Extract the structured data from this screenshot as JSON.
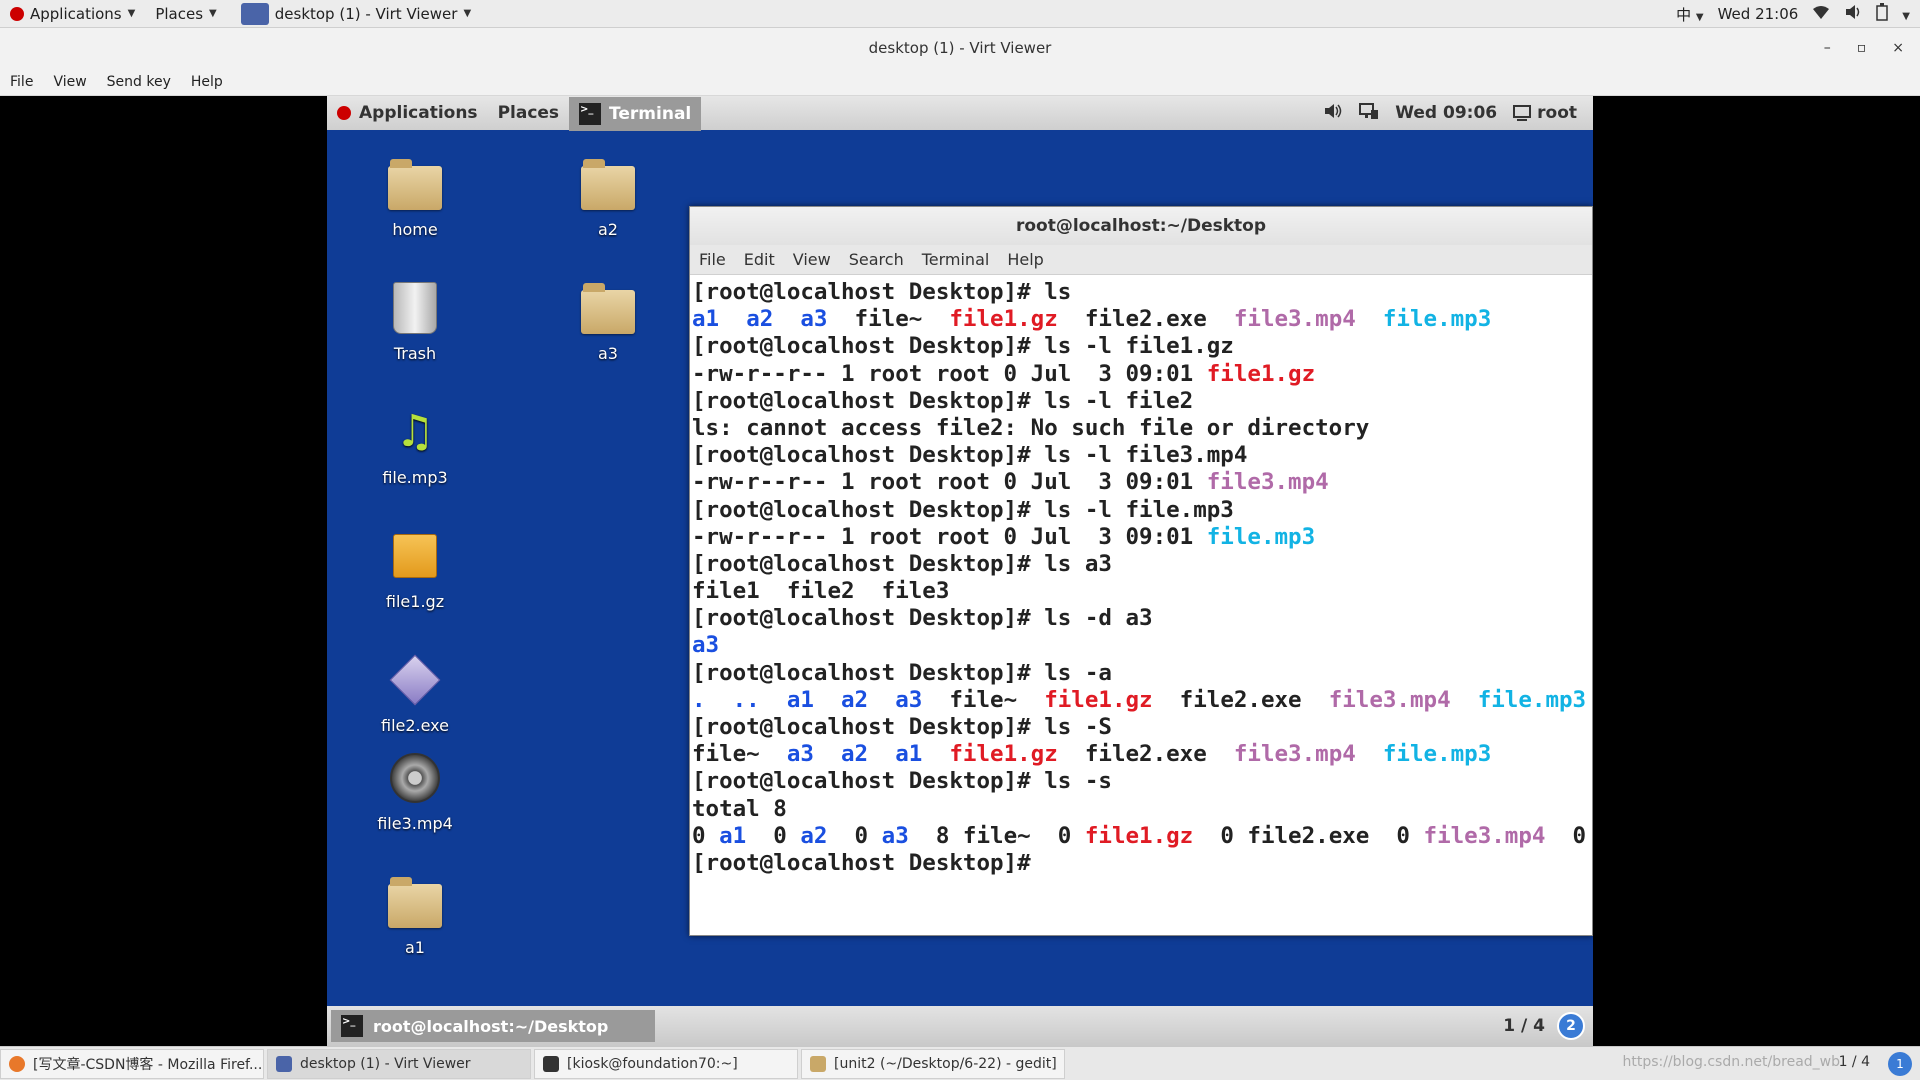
{
  "host": {
    "topbar": {
      "applications": "Applications",
      "places": "Places",
      "window_title": "desktop (1) - Virt Viewer",
      "input_method": "中",
      "clock": "Wed 21:06"
    },
    "viewer_title": "desktop (1) - Virt Viewer",
    "viewer_controls": [
      "–",
      "▫",
      "×"
    ],
    "menu": [
      "File",
      "View",
      "Send key",
      "Help"
    ],
    "taskbar": [
      {
        "label": "[写文章-CSDN博客 - Mozilla Firef...",
        "icon_color": "#e8782a"
      },
      {
        "label": "desktop (1) - Virt Viewer",
        "icon_color": "#4a64a8"
      },
      {
        "label": "[kiosk@foundation70:~]",
        "icon_color": "#333333"
      },
      {
        "label": "[unit2 (~/Desktop/6-22) - gedit]",
        "icon_color": "#c9a868"
      }
    ],
    "watermark": "https://blog.csdn.net/bread_wb",
    "pager": "1 / 4",
    "badge": "1"
  },
  "vm": {
    "topbar": {
      "applications": "Applications",
      "places": "Places",
      "terminal_tab": "Terminal",
      "clock": "Wed 09:06",
      "user": "root"
    },
    "desktop_icons": {
      "home": "home",
      "trash": "Trash",
      "music": "file.mp3",
      "archive": "file1.gz",
      "exe": "file2.exe",
      "video": "file3.mp4",
      "a1": "a1",
      "a2": "a2",
      "a3": "a3"
    },
    "terminal": {
      "title": "root@localhost:~/Desktop",
      "menu": [
        "File",
        "Edit",
        "View",
        "Search",
        "Terminal",
        "Help"
      ],
      "lines": [
        [
          [
            "[root@localhost Desktop]# ls",
            ""
          ]
        ],
        [
          [
            "a1",
            "dir"
          ],
          [
            "  ",
            ""
          ],
          [
            "a2",
            "dir"
          ],
          [
            "  ",
            ""
          ],
          [
            "a3",
            "dir"
          ],
          [
            "  file~  ",
            ""
          ],
          [
            "file1.gz",
            "red"
          ],
          [
            "  file2.exe  ",
            ""
          ],
          [
            "file3.mp4",
            "mag"
          ],
          [
            "  ",
            ""
          ],
          [
            "file.mp3",
            "cyan"
          ]
        ],
        [
          [
            "[root@localhost Desktop]# ls -l file1.gz",
            ""
          ]
        ],
        [
          [
            "-rw-r--r-- 1 root root 0 Jul  3 09:01 ",
            ""
          ],
          [
            "file1.gz",
            "red"
          ]
        ],
        [
          [
            "[root@localhost Desktop]# ls -l file2",
            ""
          ]
        ],
        [
          [
            "ls: cannot access file2: No such file or directory",
            ""
          ]
        ],
        [
          [
            "[root@localhost Desktop]# ls -l file3.mp4",
            ""
          ]
        ],
        [
          [
            "-rw-r--r-- 1 root root 0 Jul  3 09:01 ",
            ""
          ],
          [
            "file3.mp4",
            "mag"
          ]
        ],
        [
          [
            "[root@localhost Desktop]# ls -l file.mp3",
            ""
          ]
        ],
        [
          [
            "-rw-r--r-- 1 root root 0 Jul  3 09:01 ",
            ""
          ],
          [
            "file.mp3",
            "cyan"
          ]
        ],
        [
          [
            "[root@localhost Desktop]# ls a3",
            ""
          ]
        ],
        [
          [
            "file1  file2  file3",
            ""
          ]
        ],
        [
          [
            "[root@localhost Desktop]# ls -d a3",
            ""
          ]
        ],
        [
          [
            "a3",
            "dir"
          ]
        ],
        [
          [
            "[root@localhost Desktop]# ls -a",
            ""
          ]
        ],
        [
          [
            ".",
            "dir"
          ],
          [
            "  ",
            ""
          ],
          [
            "..",
            "dir"
          ],
          [
            "  ",
            ""
          ],
          [
            "a1",
            "dir"
          ],
          [
            "  ",
            ""
          ],
          [
            "a2",
            "dir"
          ],
          [
            "  ",
            ""
          ],
          [
            "a3",
            "dir"
          ],
          [
            "  file~  ",
            ""
          ],
          [
            "file1.gz",
            "red"
          ],
          [
            "  file2.exe  ",
            ""
          ],
          [
            "file3.mp4",
            "mag"
          ],
          [
            "  ",
            ""
          ],
          [
            "file.mp3",
            "cyan"
          ]
        ],
        [
          [
            "[root@localhost Desktop]# ls -S",
            ""
          ]
        ],
        [
          [
            "file~  ",
            ""
          ],
          [
            "a3",
            "dir"
          ],
          [
            "  ",
            ""
          ],
          [
            "a2",
            "dir"
          ],
          [
            "  ",
            ""
          ],
          [
            "a1",
            "dir"
          ],
          [
            "  ",
            ""
          ],
          [
            "file1.gz",
            "red"
          ],
          [
            "  file2.exe  ",
            ""
          ],
          [
            "file3.mp4",
            "mag"
          ],
          [
            "  ",
            ""
          ],
          [
            "file.mp3",
            "cyan"
          ]
        ],
        [
          [
            "[root@localhost Desktop]# ls -s",
            ""
          ]
        ],
        [
          [
            "total 8",
            ""
          ]
        ],
        [
          [
            "0 ",
            ""
          ],
          [
            "a1",
            "dir"
          ],
          [
            "  0 ",
            ""
          ],
          [
            "a2",
            "dir"
          ],
          [
            "  0 ",
            ""
          ],
          [
            "a3",
            "dir"
          ],
          [
            "  8 file~  0 ",
            ""
          ],
          [
            "file1.gz",
            "red"
          ],
          [
            "  0 file2.exe  0 ",
            ""
          ],
          [
            "file3.mp4",
            "mag"
          ],
          [
            "  0",
            ""
          ]
        ],
        [
          [
            "[root@localhost Desktop]# ",
            ""
          ]
        ]
      ]
    },
    "bottombar": {
      "task": "root@localhost:~/Desktop",
      "pager": "1 / 4",
      "badge": "2"
    }
  }
}
